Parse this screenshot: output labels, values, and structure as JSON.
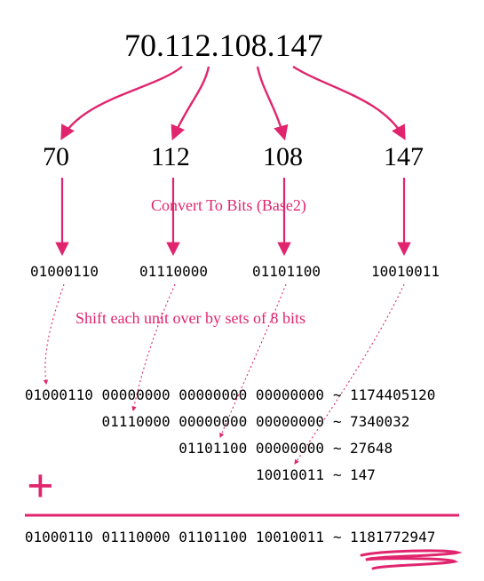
{
  "ip": "70.112.108.147",
  "octets": {
    "o1": "70",
    "o2": "112",
    "o3": "108",
    "o4": "147"
  },
  "labels": {
    "convert": "Convert To Bits (Base2)",
    "shift": "Shift each unit over by sets of 8 bits"
  },
  "bits": {
    "b1": "01000110",
    "b2": "01110000",
    "b3": "01101100",
    "b4": "10010011"
  },
  "shifted": {
    "row1_bin": "01000110 00000000 00000000 00000000",
    "row1_dec": "1174405120",
    "row2_bin": "01110000 00000000 00000000",
    "row2_dec": "7340032",
    "row3_bin": "01101100 00000000",
    "row3_dec": "27648",
    "row4_bin": "10010011",
    "row4_dec": "147"
  },
  "result": {
    "bin": "01000110 01110000 01101100 10010011",
    "dec": "1181772947"
  },
  "sep": "~",
  "plus": "+"
}
